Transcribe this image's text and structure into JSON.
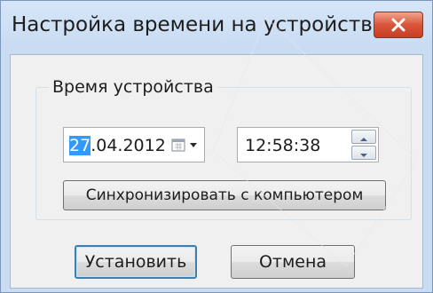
{
  "window": {
    "title": "Настройка времени на устройстве",
    "close_icon": "close-icon"
  },
  "group": {
    "label": "Время устройства"
  },
  "date": {
    "selected_part": "27",
    "rest": ".04.2012",
    "calendar_icon": "calendar-dropdown-icon"
  },
  "time": {
    "value": "12:58:38",
    "up_icon": "spin-up-icon",
    "down_icon": "spin-down-icon"
  },
  "buttons": {
    "sync_label": "Синхронизировать с компьютером",
    "set_label": "Установить",
    "cancel_label": "Отмена"
  },
  "colors": {
    "selection": "#3399ff",
    "close_button": "#d9553a",
    "default_button_border": "#3c7fb1"
  }
}
